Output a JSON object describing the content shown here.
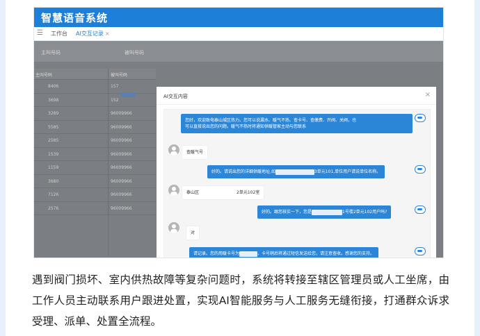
{
  "app": {
    "title": "智慧语音系统",
    "tabs": [
      {
        "label": "工作台"
      },
      {
        "label": "AI交互记录",
        "close": "×"
      }
    ]
  },
  "filter": {
    "label1": "主叫号码",
    "label2": "被叫号码"
  },
  "table": {
    "headers": [
      "主叫号码",
      "被叫号码"
    ],
    "rows": [
      [
        "8406",
        "157"
      ],
      [
        "3698",
        "152"
      ],
      [
        "3289",
        "96009966"
      ],
      [
        "5585",
        "96009966"
      ],
      [
        "2585",
        "96009966"
      ],
      [
        "1539",
        "96009966"
      ],
      [
        "1159",
        "96009966"
      ],
      [
        "3680",
        "96009966"
      ],
      [
        "7126",
        "96009966"
      ],
      [
        "2576",
        "96009966"
      ]
    ]
  },
  "modal": {
    "title": "AI交互内容",
    "close": "×",
    "messages": [
      {
        "from": "bot",
        "line1": "您好，欢迎致电泰山城区热力。您可以说漏水、暖气不热、查卡号、查缴费、开阀、关阀，也",
        "line2": "可以直接说出您的问题。暖气不热时将通知供暖管家主动与您联系"
      },
      {
        "from": "user",
        "text": "查暖气号"
      },
      {
        "from": "bot",
        "pre": "好的。请说出您的详细供暖地址,如",
        "post": "3单元101,单位用户请说单位名称。"
      },
      {
        "from": "user",
        "pre": "泰山区",
        "post": "2单元102室"
      },
      {
        "from": "bot",
        "pre": "好的。跟您核实一下，您是",
        "post": "1号楼2单元102用户吗?"
      },
      {
        "from": "user",
        "text": "对"
      },
      {
        "from": "bot",
        "pre": "请记录。您的用暖卡号为",
        "post": "，卡号稍后将通过短信发送给您，请注意查收。感谢您的支持。"
      }
    ]
  },
  "caption": "遇到阀门损坏、室内供热故障等复杂问题时，系统将转接至辖区管理员或人工坐席，由工作人员主动联系用户跟进处置，实现AI智能服务与人工服务无缝衔接，打通群众诉求受理、派单、处置全流程。"
}
